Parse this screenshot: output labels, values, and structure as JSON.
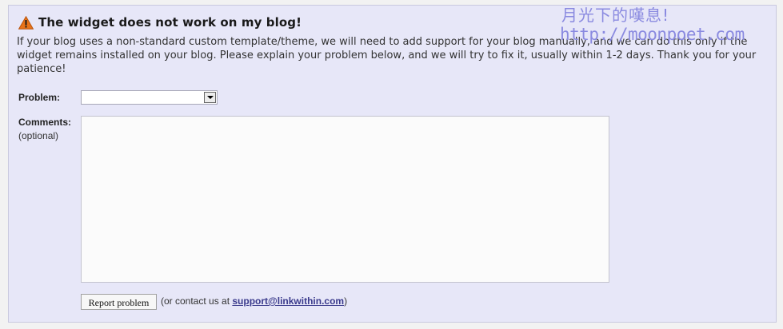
{
  "widget_form": {
    "title": "The widget does not work on my blog!",
    "description": "If your blog uses a non-standard custom template/theme, we will need to add support for your blog manually, and we can do this only if the widget remains installed on your blog. Please explain your problem below, and we will try to fix it, usually within 1-2 days. Thank you for your patience!",
    "problem_label": "Problem:",
    "problem_selected": "",
    "comments_label": "Comments:",
    "comments_optional": "(optional)",
    "comments_value": "",
    "report_button": "Report problem",
    "contact_prefix": "(or contact us at ",
    "contact_email": "support@linkwithin.com",
    "contact_suffix": ")"
  },
  "watermark": {
    "chinese_text": "月光下的嘆息!",
    "url_text": "http://moonpoet.com"
  },
  "colors": {
    "panel_background": "#e7e7f8",
    "link": "#3a3a8c",
    "watermark": "#8a8ae0",
    "warning_icon": "#e8731a"
  },
  "icons": {
    "title_icon": "warning-triangle-icon",
    "select_icon": "dropdown-arrow-icon"
  }
}
